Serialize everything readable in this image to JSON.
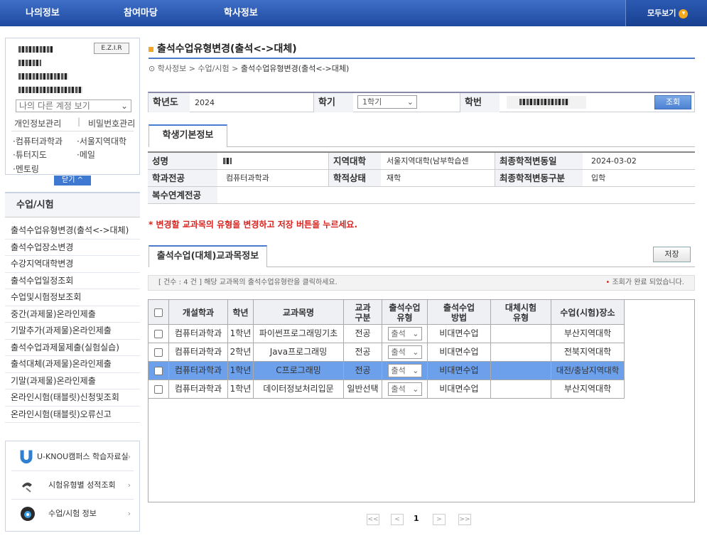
{
  "topnav": {
    "menu1": "나의정보",
    "menu2": "참여마당",
    "menu3": "학사정보",
    "all_label": "모두보기",
    "all_icon": "chevron-down-icon"
  },
  "profile": {
    "photo_label": "E.Z.I.R",
    "account_select": "나의 다른 계정 보기",
    "link_personal": "개인정보관리",
    "link_sep": "|",
    "link_pw": "비밀번호관리",
    "link_dept": "·컴퓨터과학과",
    "link_region": "·서울지역대학",
    "link_tutor": "·튜터지도",
    "link_mail": "·메일",
    "link_mentor": "·멘토링",
    "close_button": "닫기"
  },
  "sidebar": {
    "heading": "수업/시험",
    "items": [
      "출석수업유형변경(출석<->대체)",
      "출석수업장소변경",
      "수강지역대학변경",
      "출석수업일정조회",
      "수업및시험정보조회",
      "중간(과제물)온라인제출",
      "기말추가(과제물)온라인제출",
      "출석수업과제물제출(실험실습)",
      "출석대체(과제물)온라인제출",
      "기말(과제물)온라인제출",
      "온라인시험(태블릿)신청및조회",
      "온라인시험(태블릿)오류신고"
    ]
  },
  "quick": [
    {
      "label": "U-KNOU캠퍼스 학습자료실",
      "icon": "u-knou-logo-icon"
    },
    {
      "label": "시험유형별 성적조회",
      "icon": "pen-icon"
    },
    {
      "label": "수업/시험 정보",
      "icon": "headset-icon"
    }
  ],
  "page": {
    "title": "출석수업유형변경(출석<->대체)",
    "crumb_home": "학사정보",
    "crumb_sep1": ">",
    "crumb_mid": "수업/시험",
    "crumb_sep2": ">",
    "crumb_current": "출석수업유형변경(출석<->대체)"
  },
  "search": {
    "year_label": "학년도",
    "year_value": "2024",
    "term_label": "학기",
    "term_value": "1학기",
    "id_label": "학번",
    "search_button": "조회"
  },
  "student_tab": "학생기본정보",
  "student": {
    "name_label": "성명",
    "region_label": "지역대학",
    "region_value": "서울지역대학(남부학습센",
    "last_change_date_label": "최종학적변동일",
    "last_change_date": "2024-03-02",
    "major_label": "학과전공",
    "major_value": "컴퓨터과학과",
    "status_label": "학적상태",
    "status_value": "재학",
    "last_change_type_label": "최종학적변동구분",
    "last_change_type": "입학",
    "double_major_label": "복수연계전공"
  },
  "notice": "* 변경할 교과목의 유형을 변경하고 저장 버튼을 누르세요.",
  "course_tab": "출석수업(대체)교과목정보",
  "save_button": "저장",
  "countbar": {
    "left": "[ 건수 : 4 건 ] 해당 교과목의 출석수업유형란을 클릭하세요.",
    "right": "조회가 완료 되었습니다."
  },
  "table": {
    "headers": {
      "dept": "개설학과",
      "grade": "학년",
      "course": "교과목명",
      "category": "교과\n구분",
      "type": "출석수업\n유형",
      "method": "출석수업\n방법",
      "alt_exam": "대체시험\n유형",
      "place": "수업(시험)장소"
    },
    "rows": [
      {
        "dept": "컴퓨터과학과",
        "grade": "1학년",
        "course": "파이썬프로그래밍기초",
        "category": "전공",
        "type": "출석",
        "method": "비대면수업",
        "alt_exam": "",
        "place": "부산지역대학"
      },
      {
        "dept": "컴퓨터과학과",
        "grade": "2학년",
        "course": "Java프로그래밍",
        "category": "전공",
        "type": "출석",
        "method": "비대면수업",
        "alt_exam": "",
        "place": "전북지역대학"
      },
      {
        "dept": "컴퓨터과학과",
        "grade": "1학년",
        "course": "C프로그래밍",
        "category": "전공",
        "type": "출석",
        "method": "비대면수업",
        "alt_exam": "",
        "place": "대전/충남지역대학"
      },
      {
        "dept": "컴퓨터과학과",
        "grade": "1학년",
        "course": "데이터정보처리입문",
        "category": "일반선택",
        "type": "출석",
        "method": "비대면수업",
        "alt_exam": "",
        "place": "부산지역대학"
      }
    ]
  },
  "pager": {
    "first": "<<",
    "prev": "<",
    "current": "1",
    "next": ">",
    "last": ">>"
  },
  "colors": {
    "nav": "#2a57b0",
    "accent": "#4a7bd0",
    "selected_row": "#6ca0eb",
    "notice": "#d9231e"
  }
}
